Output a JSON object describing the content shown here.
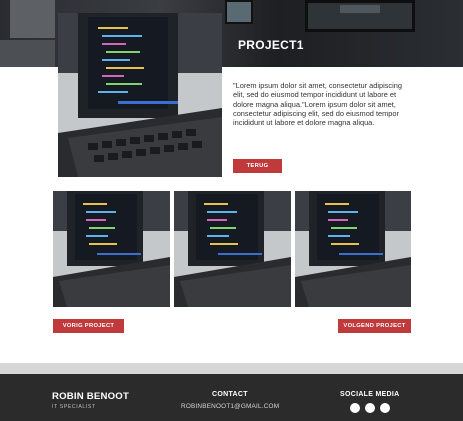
{
  "project": {
    "title": "PROJECT1",
    "description": "\"Lorem ipsum dolor sit amet, consectetur adipiscing elit, sed do eiusmod tempor incididunt ut labore et dolore magna aliqua.\"Lorem ipsum dolor sit amet, consectetur adipiscing elit, sed do eiusmod tempor incididunt ut labore et dolore magna aliqua.",
    "back_label": "TERUG"
  },
  "navigation": {
    "prev_label": "VORIG PROJECT",
    "next_label": "VOLGEND PROJECT"
  },
  "footer": {
    "name": "ROBIN BENOOT",
    "role": "IT SPECIALIST",
    "contact_heading": "CONTACT",
    "email": "ROBINBENOOT1@GMAIL.COM",
    "social_heading": "SOCIALE MEDIA",
    "social_icons": [
      "social-icon-1",
      "social-icon-2",
      "social-icon-3"
    ]
  },
  "colors": {
    "accent": "#c0393b",
    "footer_bg": "#2b2b2b",
    "divider": "#d7d7d7"
  }
}
